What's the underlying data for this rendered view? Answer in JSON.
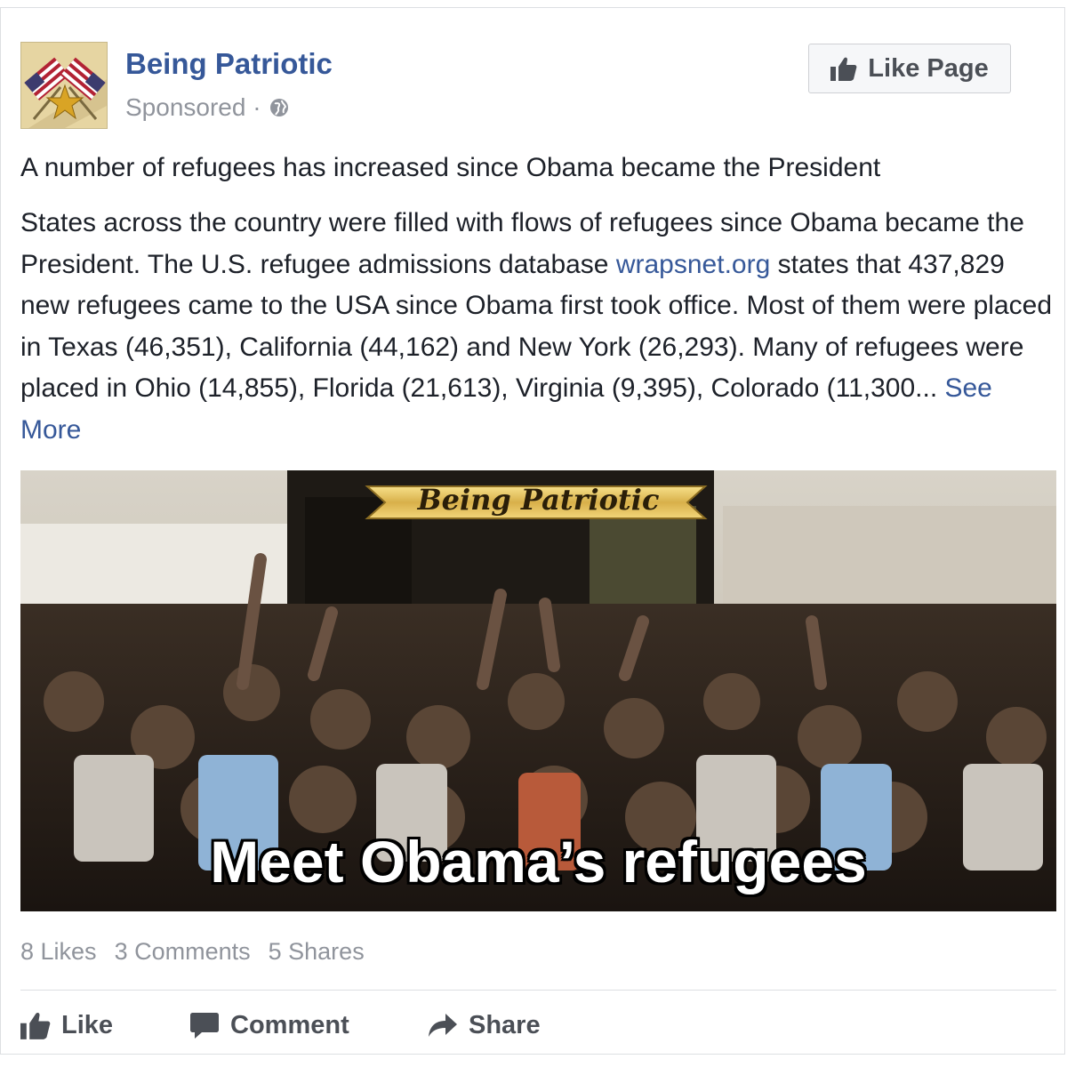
{
  "post": {
    "page_name": "Being Patriotic",
    "sponsored": "Sponsored ·",
    "like_page_label": "Like Page",
    "headline": "A number of refugees has increased since Obama became the President",
    "body_part1": "States across the country were filled with flows of refugees since Obama became the President. The U.S. refugee admissions database ",
    "body_link": "wrapsnet.org",
    "body_part2": " states that 437,829 new refugees came to the USA since Obama first took office. Most of them were placed in Texas (46,351), California (44,162) and New York (26,293). Many of refugees were placed in Ohio (14,855), Florida (21,613), Virginia (9,395), Colorado (11,300... ",
    "see_more": "See More"
  },
  "image": {
    "banner": "Being Patriotic",
    "caption": "Meet Obama’s refugees"
  },
  "stats": {
    "likes": "8 Likes",
    "comments": "3 Comments",
    "shares": "5 Shares"
  },
  "actions": {
    "like": "Like",
    "comment": "Comment",
    "share": "Share"
  },
  "icons": {
    "page_avatar": "crossed-flags-star-icon",
    "privacy": "globe-icon",
    "like_page": "thumbs-up-icon",
    "like": "thumbs-up-icon",
    "comment": "speech-bubble-icon",
    "share": "share-arrow-icon"
  },
  "colors": {
    "link": "#365899",
    "muted": "#90949c",
    "text": "#1d2129"
  }
}
